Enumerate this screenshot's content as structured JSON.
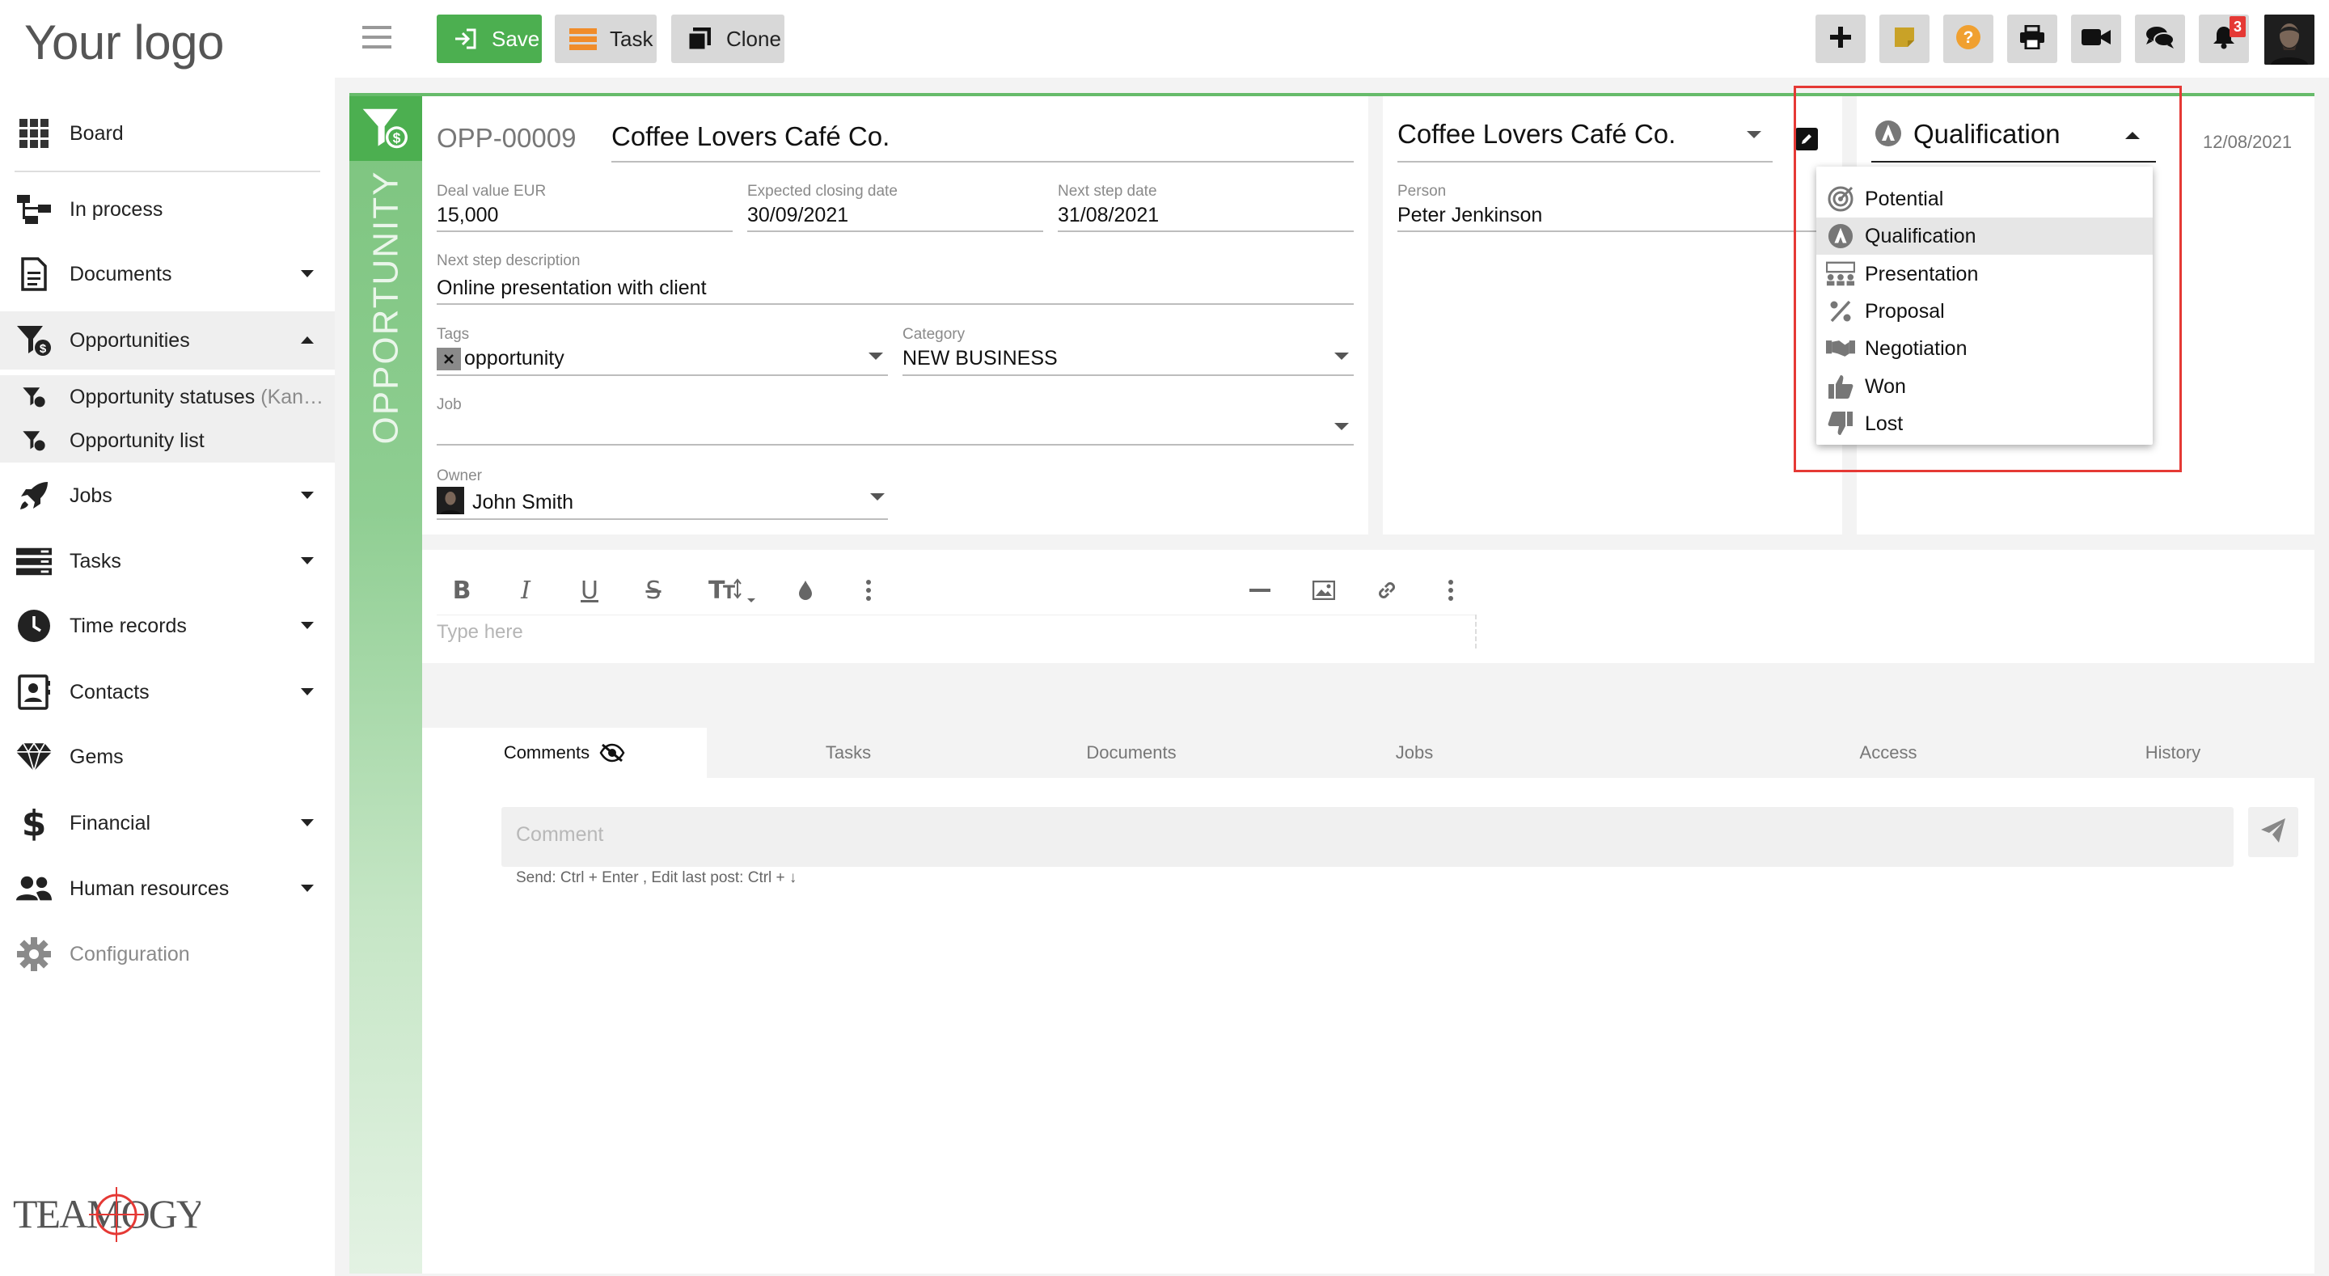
{
  "sidebar": {
    "logo": "Your logo",
    "items": [
      {
        "label": "Board",
        "icon": "grid-icon"
      },
      {
        "label": "In process",
        "icon": "flow-icon"
      },
      {
        "label": "Documents",
        "icon": "document-icon"
      },
      {
        "label": "Opportunities",
        "icon": "opportunity-funnel-icon"
      },
      {
        "label": "Opportunity statuses",
        "label_suffix": "(Kan…",
        "icon": "opportunity-funnel-icon"
      },
      {
        "label": "Opportunity list",
        "icon": "opportunity-funnel-icon"
      },
      {
        "label": "Jobs",
        "icon": "rocket-icon"
      },
      {
        "label": "Tasks",
        "icon": "tasks-icon"
      },
      {
        "label": "Time records",
        "icon": "clock-icon"
      },
      {
        "label": "Contacts",
        "icon": "contacts-icon"
      },
      {
        "label": "Gems",
        "icon": "gem-icon"
      },
      {
        "label": "Financial",
        "icon": "dollar-icon"
      },
      {
        "label": "Human resources",
        "icon": "people-icon"
      },
      {
        "label": "Configuration",
        "icon": "gear-icon"
      }
    ],
    "brand": "TEAMOGY"
  },
  "toolbar": {
    "save_label": "Save",
    "task_label": "Task",
    "clone_label": "Clone",
    "notifications_count": "3",
    "accent_green": "#4caf50",
    "help_color": "#f0a030",
    "note_color": "#c9a227"
  },
  "opportunity": {
    "vertical_label": "OPPORTUNITY",
    "code": "OPP-00009",
    "title": "Coffee Lovers Café Co.",
    "deal_value_label": "Deal value EUR",
    "deal_value": "15,000",
    "closing_date_label": "Expected closing date",
    "closing_date": "30/09/2021",
    "next_step_date_label": "Next step date",
    "next_step_date": "31/08/2021",
    "next_step_desc_label": "Next step description",
    "next_step_desc": "Online presentation with client",
    "tags_label": "Tags",
    "tag": "opportunity",
    "category_label": "Category",
    "category": "NEW BUSINESS",
    "job_label": "Job",
    "job": "",
    "owner_label": "Owner",
    "owner": "John Smith"
  },
  "company": {
    "name": "Coffee Lovers Café Co.",
    "person_label": "Person",
    "person": "Peter Jenkinson"
  },
  "status": {
    "current": "Qualification",
    "date": "12/08/2021",
    "options": [
      {
        "label": "Potential",
        "icon": "target-icon"
      },
      {
        "label": "Qualification",
        "icon": "qualification-icon"
      },
      {
        "label": "Presentation",
        "icon": "presentation-icon"
      },
      {
        "label": "Proposal",
        "icon": "percent-icon"
      },
      {
        "label": "Negotiation",
        "icon": "handshake-icon"
      },
      {
        "label": "Won",
        "icon": "thumbs-up-icon"
      },
      {
        "label": "Lost",
        "icon": "thumbs-down-icon"
      }
    ],
    "highlight_color": "#e53935"
  },
  "editor": {
    "placeholder": "Type here"
  },
  "tabs": [
    {
      "label": "Comments"
    },
    {
      "label": "Tasks"
    },
    {
      "label": "Documents"
    },
    {
      "label": "Jobs"
    },
    {
      "label": "Access"
    },
    {
      "label": "History"
    }
  ],
  "comments": {
    "placeholder": "Comment",
    "hint": "Send: Ctrl + Enter , Edit last post: Ctrl + ↓"
  }
}
